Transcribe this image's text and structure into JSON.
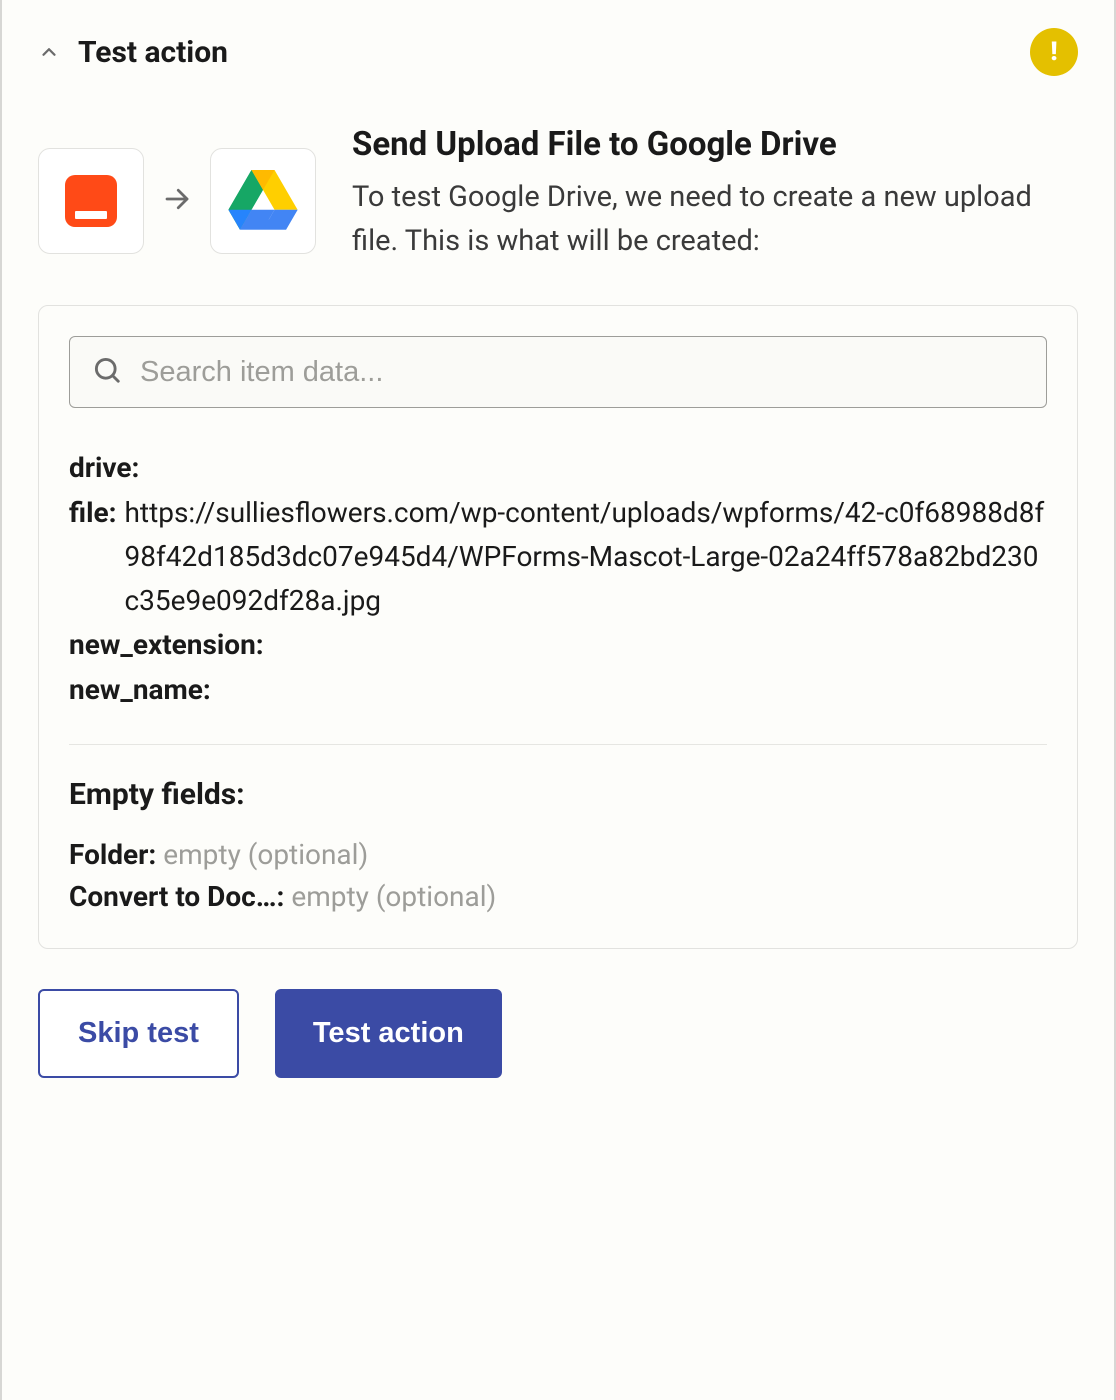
{
  "header": {
    "title": "Test action"
  },
  "info": {
    "title": "Send Upload File to Google Drive",
    "description": "To test Google Drive, we need to create a new upload file. This is what will be created:"
  },
  "search": {
    "placeholder": "Search item data..."
  },
  "fields": {
    "drive": {
      "key": "drive:",
      "value": ""
    },
    "file": {
      "key": "file:",
      "value": "https://sulliesflowers.com/wp-content/uploads/wpforms/42-c0f68988d8f98f42d185d3dc07e945d4/WPForms-Mascot-Large-02a24ff578a82bd230c35e9e092df28a.jpg"
    },
    "new_extension": {
      "key": "new_extension:",
      "value": ""
    },
    "new_name": {
      "key": "new_name:",
      "value": ""
    }
  },
  "empty": {
    "heading": "Empty fields:",
    "folder": {
      "key": "Folder:",
      "value": "empty (optional)"
    },
    "convert": {
      "key": "Convert to Doc…:",
      "value": "empty (optional)"
    }
  },
  "buttons": {
    "skip": "Skip test",
    "test": "Test action"
  },
  "icons": {
    "source": "wpforms-icon",
    "target": "google-drive-icon"
  }
}
